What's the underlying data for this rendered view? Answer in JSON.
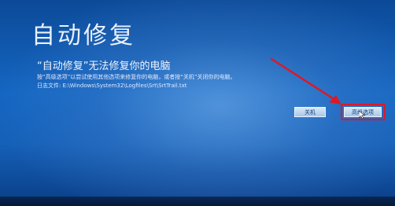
{
  "screen": {
    "title": "自动修复",
    "heading": "“自动修复”无法修复你的电脑",
    "description": "按“高级选项”以尝试使用其他选项来修复你的电脑，或者按“关机”关闭你的电脑。",
    "log_file": "日志文件: E:\\Windows\\System32\\Logfiles\\Srt\\SrtTrail.txt"
  },
  "buttons": {
    "shutdown": "关机",
    "advanced_options": "高级选项"
  },
  "colors": {
    "annotation_red": "#d91a2a"
  },
  "icons": {
    "pointer": "mouse-pointer-icon",
    "annotation": "red-arrow-annotation"
  }
}
